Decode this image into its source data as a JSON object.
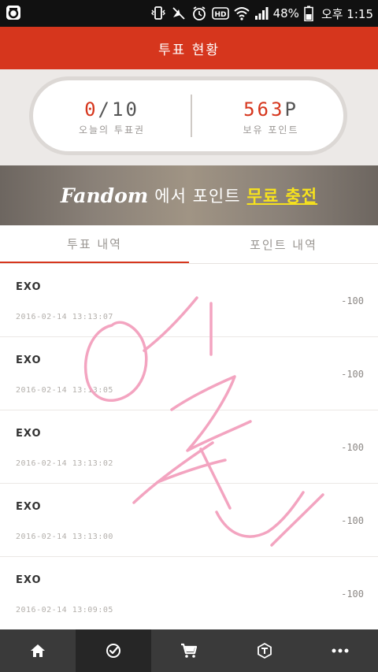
{
  "status_bar": {
    "battery_percent": "48%",
    "time": "오후 1:15",
    "icons": [
      "app-logo-icon",
      "phone-vibrate-icon",
      "mute-icon",
      "alarm-icon",
      "hd-icon",
      "wifi-icon",
      "signal-icon",
      "battery-icon"
    ]
  },
  "header": {
    "title": "투표 현황"
  },
  "summary": {
    "votes_used": "0",
    "votes_total": "10",
    "votes_label": "오늘의 투표권",
    "points_value": "563",
    "points_unit": "P",
    "points_label": "보유 포인트"
  },
  "banner": {
    "brand": "Fandom",
    "text": "에서 포인트",
    "highlight": "무료 충전"
  },
  "tabs": [
    {
      "label": "투표 내역",
      "active": true
    },
    {
      "label": "포인트 내역",
      "active": false
    }
  ],
  "history": [
    {
      "artist": "EXO",
      "datetime": "2016-02-14 13:13:07",
      "amount": "-100"
    },
    {
      "artist": "EXO",
      "datetime": "2016-02-14 13:13:05",
      "amount": "-100"
    },
    {
      "artist": "EXO",
      "datetime": "2016-02-14 13:13:02",
      "amount": "-100"
    },
    {
      "artist": "EXO",
      "datetime": "2016-02-14 13:13:00",
      "amount": "-100"
    },
    {
      "artist": "EXO",
      "datetime": "2016-02-14 13:09:05",
      "amount": "-100"
    }
  ],
  "bottom_nav": [
    {
      "icon": "home-icon",
      "active": false
    },
    {
      "icon": "vote-check-icon",
      "active": true
    },
    {
      "icon": "cart-icon",
      "active": false
    },
    {
      "icon": "token-icon",
      "active": false
    },
    {
      "icon": "more-icon",
      "active": false
    }
  ],
  "colors": {
    "accent": "#d6361d",
    "banner_highlight": "#f7e21d",
    "scribble": "#f3a4c0",
    "nav_bg": "#3a3a3a"
  }
}
